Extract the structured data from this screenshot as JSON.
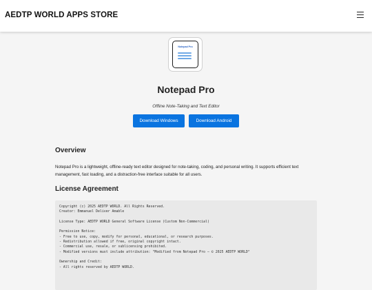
{
  "header": {
    "brand": "AEDTP WORLD APPS STORE",
    "menu_icon": "hamburger-menu-icon"
  },
  "app": {
    "icon_caption": "Notepad Pro",
    "title": "Notepad Pro",
    "tagline": "Offline Note-Taking and Text Editor",
    "buttons": {
      "windows": "Download Windows",
      "android": "Download Android"
    }
  },
  "overview": {
    "heading": "Overview",
    "text": "Notepad Pro is a lightweight, offline-ready text editor designed for note-taking, coding, and personal writing. It supports efficient text management, fast loading, and a distraction-free interface suitable for all users."
  },
  "license": {
    "heading": "License Agreement",
    "lines": [
      "Copyright (c) 2025 AEDTP WORLD. All Rights Reserved.",
      "Creator: Emmanuel Deliver Amable",
      "",
      "License Type: AEDTP WORLD General Software License (Custom Non-Commercial)",
      "",
      "Permission Notice:",
      "- Free to use, copy, modify for personal, educational, or research purposes.",
      "- Redistribution allowed if free, original copyright intact.",
      "- Commercial use, resale, or sublicensing prohibited.",
      "- Modified versions must include attribution: \"Modified from Notepad Pro – © 2025 AEDTP WORLD\"",
      "",
      "Ownership and Credit:",
      "- All rights reserved by AEDTP WORLD."
    ]
  },
  "colors": {
    "accent": "#0a74e0",
    "page_background": "#f5f5f5",
    "code_background": "#e9e9e9"
  }
}
